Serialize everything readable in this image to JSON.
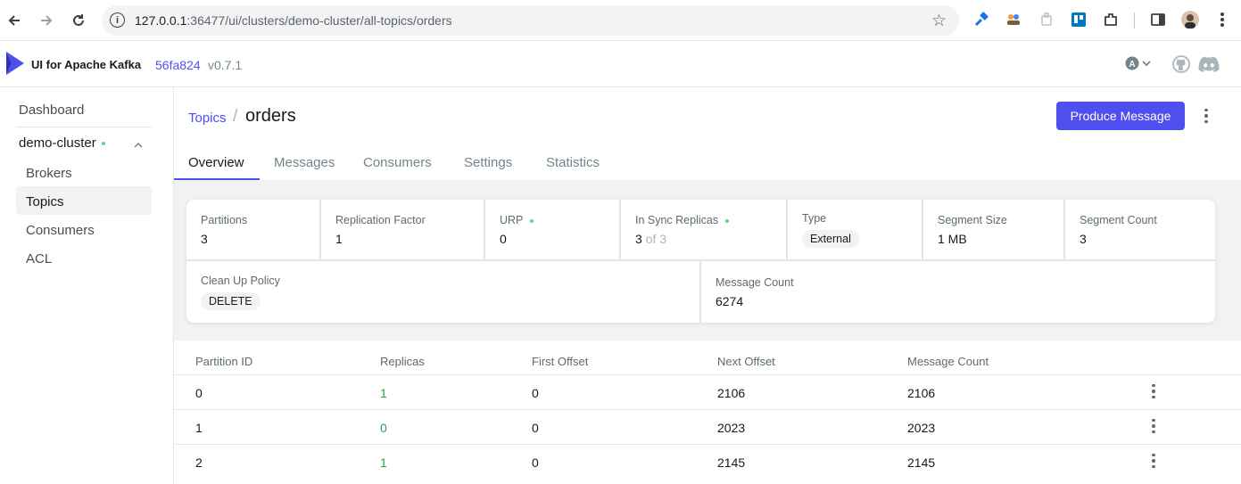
{
  "browser": {
    "url_host": "127.0.0.1",
    "url_rest": ":36477/ui/clusters/demo-cluster/all-topics/orders"
  },
  "header": {
    "title": "UI for Apache Kafka",
    "version_hash": "56fa824",
    "version": "v0.7.1",
    "account_initial": "A"
  },
  "sidebar": {
    "dashboard": "Dashboard",
    "cluster": "demo-cluster",
    "items": [
      {
        "label": "Brokers"
      },
      {
        "label": "Topics"
      },
      {
        "label": "Consumers"
      },
      {
        "label": "ACL"
      }
    ]
  },
  "breadcrumb": {
    "parent": "Topics",
    "separator": "/",
    "current": "orders"
  },
  "actions": {
    "produce": "Produce Message"
  },
  "tabs": [
    {
      "label": "Overview"
    },
    {
      "label": "Messages"
    },
    {
      "label": "Consumers"
    },
    {
      "label": "Settings"
    },
    {
      "label": "Statistics"
    }
  ],
  "stats": {
    "partitions": {
      "label": "Partitions",
      "value": "3"
    },
    "replication_factor": {
      "label": "Replication Factor",
      "value": "1"
    },
    "urp": {
      "label": "URP",
      "value": "0"
    },
    "in_sync": {
      "label": "In Sync Replicas",
      "value": "3",
      "of": "of 3"
    },
    "type": {
      "label": "Type",
      "value": "External"
    },
    "segment_size": {
      "label": "Segment Size",
      "value": "1 MB"
    },
    "segment_count": {
      "label": "Segment Count",
      "value": "3"
    },
    "cleanup": {
      "label": "Clean Up Policy",
      "value": "DELETE"
    },
    "message_count": {
      "label": "Message Count",
      "value": "6274"
    }
  },
  "table": {
    "columns": [
      "Partition ID",
      "Replicas",
      "First Offset",
      "Next Offset",
      "Message Count"
    ],
    "rows": [
      [
        "0",
        "1",
        "0",
        "2106",
        "2106"
      ],
      [
        "1",
        "0",
        "0",
        "2023",
        "2023"
      ],
      [
        "2",
        "1",
        "0",
        "2145",
        "2145"
      ]
    ]
  },
  "colors": {
    "accent": "#4f4ff0",
    "ok_dot": "#5cd685",
    "replica_green": "#29a352"
  }
}
